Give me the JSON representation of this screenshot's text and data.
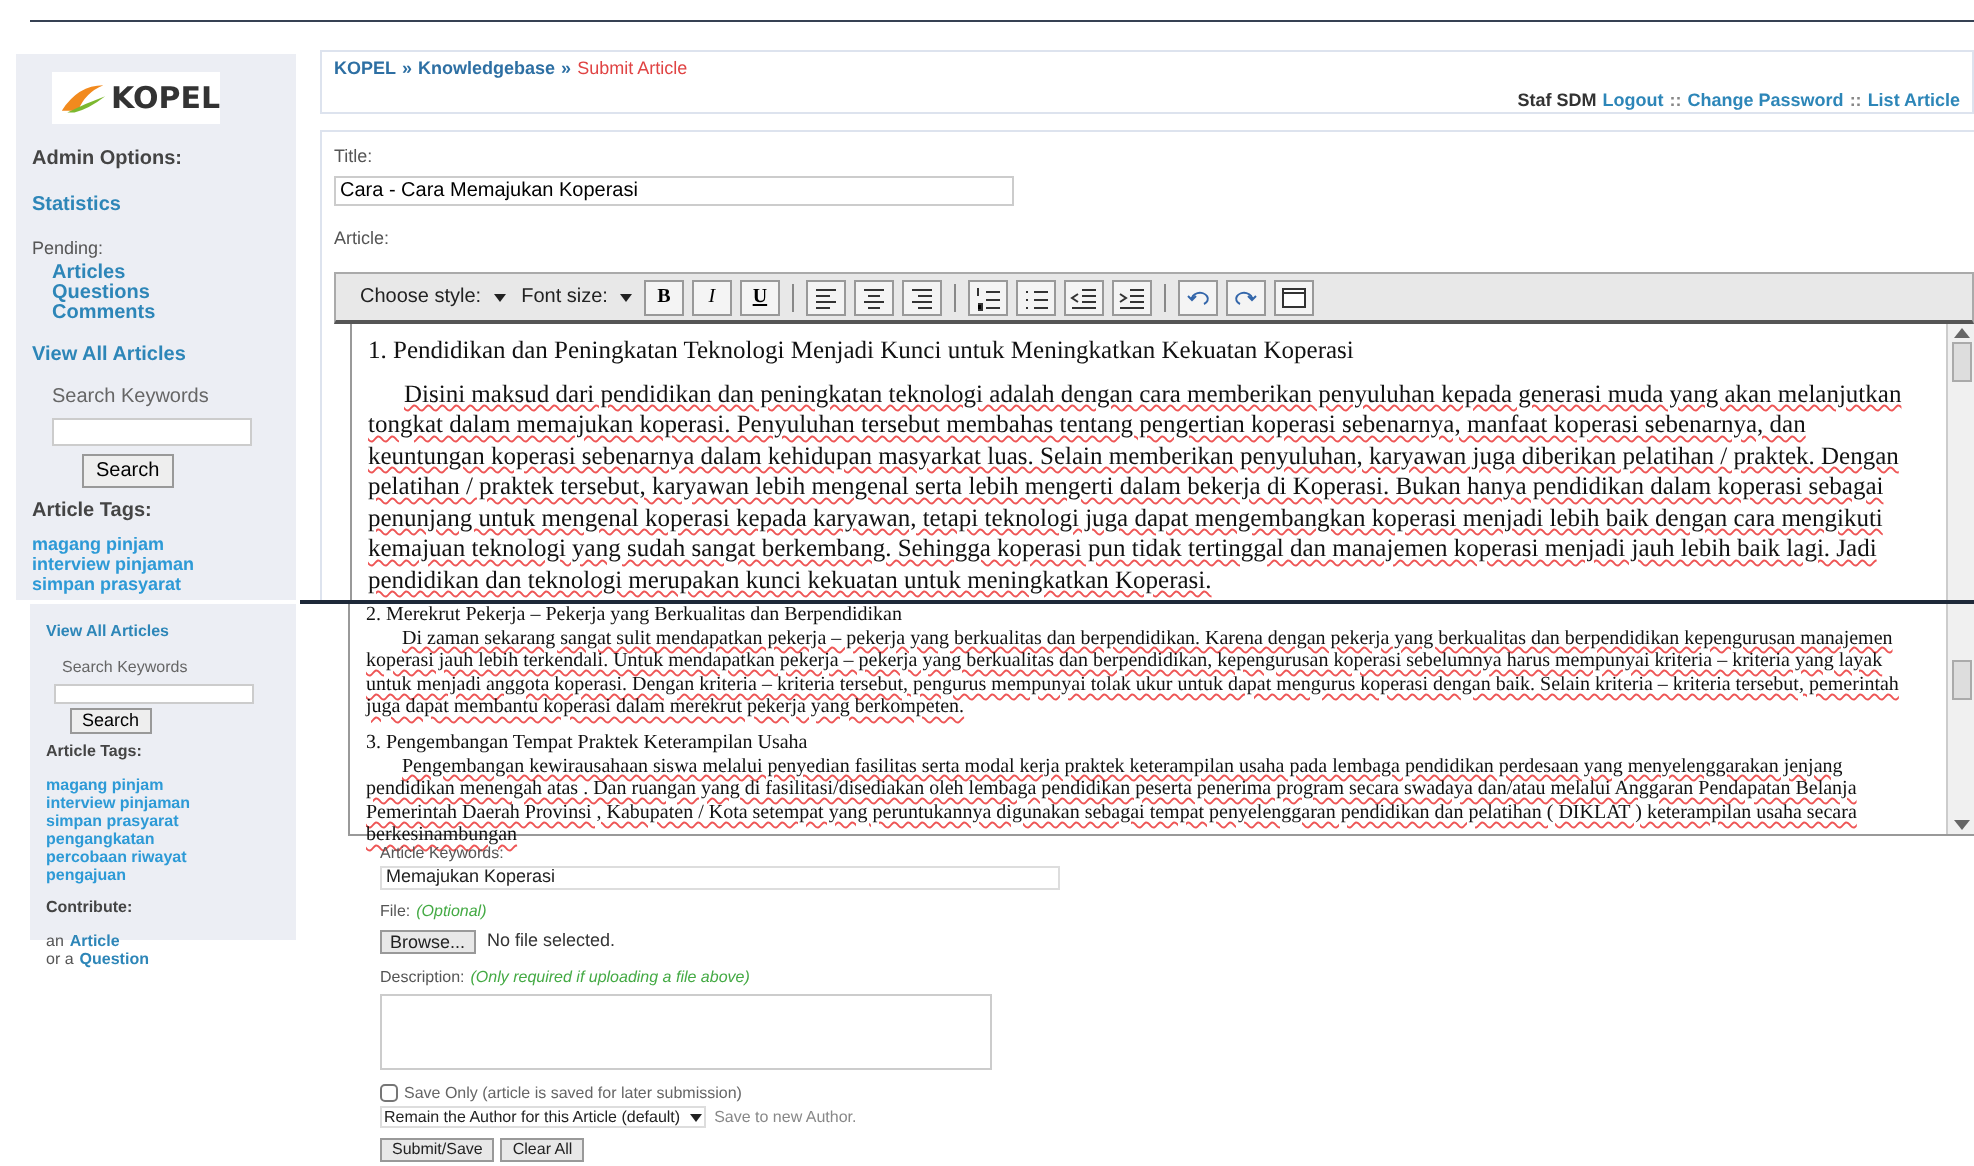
{
  "top_view": {
    "sidebar": {
      "logo_text": "KOPEL",
      "admin_heading": "Admin Options:",
      "statistics_link": "Statistics",
      "pending_label": "Pending:",
      "pending_links": [
        "Articles",
        "Questions",
        "Comments"
      ],
      "view_all_link": "View All Articles",
      "search_label": "Search Keywords",
      "search_button": "Search",
      "tags_heading": "Article Tags:",
      "tags": [
        "magang pinjam",
        "interview pinjaman",
        "simpan prasyarat"
      ]
    },
    "breadcrumb": [
      {
        "text": "KOPEL",
        "kind": "link"
      },
      {
        "text": "»",
        "kind": "separator"
      },
      {
        "text": "Knowledgebase",
        "kind": "link"
      },
      {
        "text": "»",
        "kind": "separator"
      },
      {
        "text": "Submit Article",
        "kind": "current"
      }
    ],
    "user_bar": {
      "user": "Staf SDM",
      "items": [
        {
          "text": "Logout",
          "kind": "link"
        },
        {
          "text": "::",
          "kind": "separator"
        },
        {
          "text": "Change Password",
          "kind": "link"
        },
        {
          "text": "::",
          "kind": "separator"
        },
        {
          "text": "List Article",
          "kind": "link"
        }
      ]
    },
    "title_label": "Title:",
    "title_value": "Cara - Cara Memajukan Koperasi",
    "article_label": "Article:",
    "toolbar": {
      "style_select": "Choose style:",
      "size_select": "Font size:",
      "groups": [
        [
          {
            "kind": "bold",
            "label": "B"
          },
          {
            "kind": "italic",
            "label": "I"
          },
          {
            "kind": "underline",
            "label": "U"
          }
        ],
        [
          {
            "kind": "align_left"
          },
          {
            "kind": "align_center"
          },
          {
            "kind": "align_right"
          }
        ],
        [
          {
            "kind": "ordered_list"
          },
          {
            "kind": "bullet_list"
          },
          {
            "kind": "outdent"
          },
          {
            "kind": "indent"
          }
        ],
        [
          {
            "kind": "undo"
          },
          {
            "kind": "redo"
          },
          {
            "kind": "fullscreen"
          }
        ]
      ]
    },
    "editor": {
      "heading": "1. Pendidikan dan Peningkatan Teknologi Menjadi Kunci untuk Meningkatkan Kekuatan Koperasi",
      "paragraph": "Disini maksud dari pendidikan dan peningkatan teknologi adalah dengan cara memberikan penyuluhan kepada  generasi muda yang akan melanjutkan tongkat dalam memajukan koperasi. Penyuluhan tersebut membahas tentang pengertian koperasi sebenarnya, manfaat koperasi sebenarnya, dan keuntungan koperasi sebenarnya dalam kehidupan masyarkat luas. Selain memberikan penyuluhan, karyawan juga diberikan pelatihan / praktek. Dengan pelatihan / praktek tersebut, karyawan lebih mengenal serta lebih mengerti dalam bekerja di Koperasi. Bukan hanya pendidikan dalam koperasi sebagai penunjang untuk mengenal koperasi kepada karyawan, tetapi teknologi juga dapat mengembangkan koperasi menjadi lebih baik dengan cara mengikuti kemajuan teknologi yang sudah sangat berkembang. Sehingga koperasi pun tidak tertinggal dan manajemen koperasi menjadi jauh lebih baik lagi. Jadi pendidikan dan teknologi merupakan kunci kekuatan untuk meningkatkan Koperasi."
    }
  },
  "bottom_view": {
    "sidebar": {
      "view_all_link": "View All Articles",
      "search_label": "Search Keywords",
      "search_button": "Search",
      "tags_heading": "Article Tags:",
      "tags": [
        "magang pinjam",
        "interview pinjaman",
        "simpan prasyarat",
        "pengangkatan",
        "percobaan riwayat",
        "pengajuan"
      ],
      "contribute_heading": "Contribute:",
      "contribute": [
        {
          "prefix": "an",
          "link": "Article"
        },
        {
          "prefix": "or a",
          "link": "Question"
        }
      ]
    },
    "editor": {
      "sections": [
        {
          "heading": "2. Merekrut Pekerja – Pekerja yang Berkualitas dan Berpendidikan",
          "paragraph": "Di zaman sekarang sangat sulit mendapatkan pekerja – pekerja yang berkualitas dan berpendidikan. Karena dengan pekerja yang berkualitas dan berpendidikan kepengurusan manajemen koperasi jauh lebih terkendali. Untuk mendapatkan pekerja – pekerja yang berkualitas dan berpendidikan, kepengurusan koperasi sebelumnya harus mempunyai kriteria – kriteria yang layak untuk menjadi anggota koperasi. Dengan kriteria – kriteria tersebut, pengurus mempunyai tolak ukur untuk dapat mengurus koperasi dengan baik. Selain kriteria – kriteria tersebut, pemerintah juga dapat membantu koperasi dalam merekrut pekerja yang berkompeten."
        },
        {
          "heading": "3. Pengembangan Tempat Praktek Keterampilan Usaha",
          "paragraph": "Pengembangan kewirausahaan siswa melalui penyedian fasilitas serta modal kerja praktek keterampilan usaha pada lembaga pendidikan perdesaan yang menyelenggarakan jenjang pendidikan menengah atas . Dan ruangan yang di fasilitasi/disediakan oleh lembaga pendidikan peserta penerima program secara swadaya dan/atau melalui Anggaran Pendapatan Belanja Pemerintah Daerah Provinsi , Kabupaten / Kota setempat yang peruntukannya digunakan sebagai tempat penyelenggaran pendidikan dan pelatihan ( DIKLAT ) keterampilan usaha secara berkesinambungan"
        }
      ]
    },
    "keywords_label": "Article Keywords:",
    "keywords_value": "Memajukan Koperasi",
    "file_label": "File:",
    "file_hint": "(Optional)",
    "browse_button": "Browse...",
    "file_status": "No file selected.",
    "description_label": "Description:",
    "description_hint": "(Only required if uploading a file above)",
    "save_only": {
      "label": "Save Only (article is saved for later submission)",
      "checked": false
    },
    "author_select": "Remain the Author for this Article (default)",
    "author_note": "Save to new Author.",
    "buttons": [
      "Submit/Save",
      "Clear All"
    ]
  }
}
